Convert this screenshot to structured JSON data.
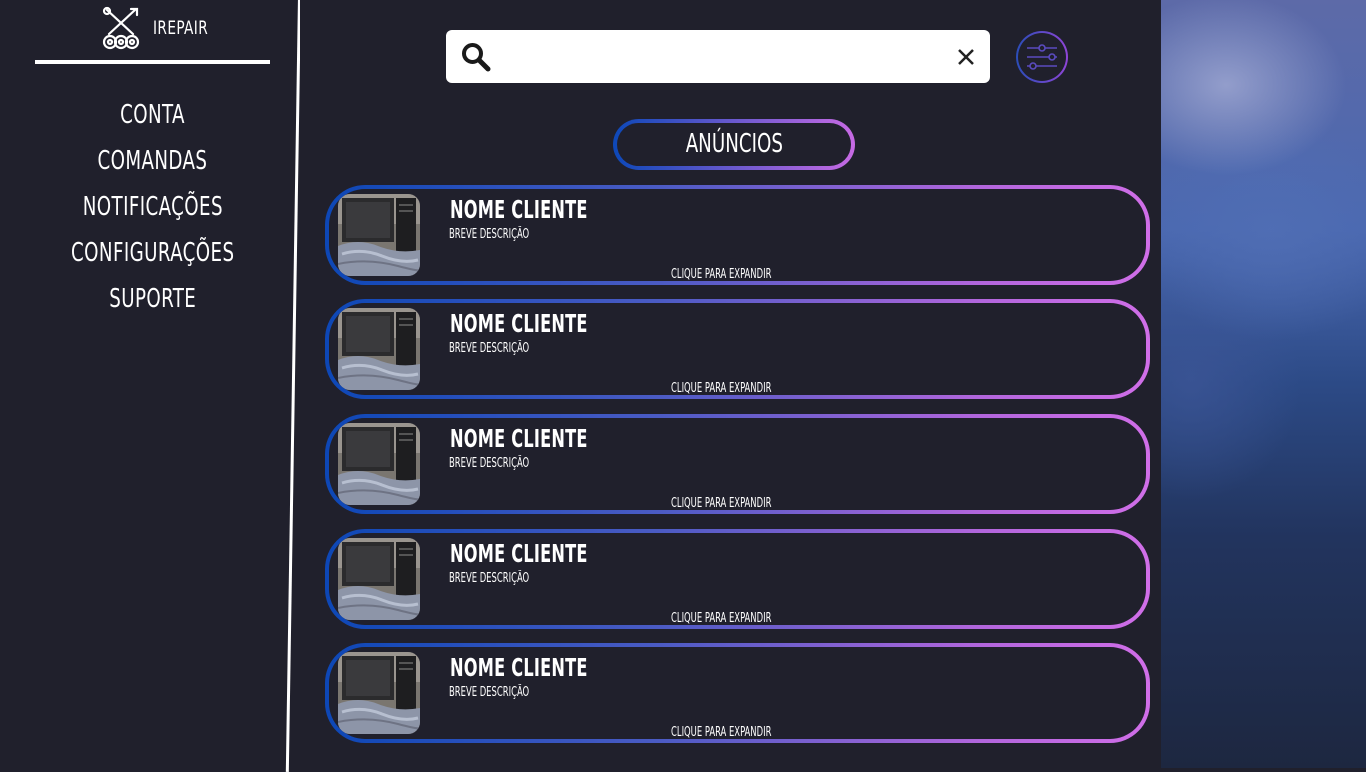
{
  "brand": {
    "name": "IREPAIR",
    "icon": "tools-gears-icon"
  },
  "nav": {
    "items": [
      {
        "label": "CONTA"
      },
      {
        "label": "COMANDAS"
      },
      {
        "label": "NOTIFICAÇÕES"
      },
      {
        "label": "CONFIGURAÇÕES"
      },
      {
        "label": "SUPORTE"
      }
    ]
  },
  "search": {
    "value": "",
    "placeholder": "",
    "icon": "search-icon",
    "clear_icon": "close-icon"
  },
  "filter": {
    "icon": "sliders-icon"
  },
  "tab": {
    "label": "ANÚNCIOS"
  },
  "cards": [
    {
      "name": "NOME CLIENTE",
      "description": "BREVE DESCRIÇÃO",
      "action": "CLIQUE PARA EXPANDIR"
    },
    {
      "name": "NOME CLIENTE",
      "description": "BREVE DESCRIÇÃO",
      "action": "CLIQUE PARA EXPANDIR"
    },
    {
      "name": "NOME CLIENTE",
      "description": "BREVE DESCRIÇÃO",
      "action": "CLIQUE PARA EXPANDIR"
    },
    {
      "name": "NOME CLIENTE",
      "description": "BREVE DESCRIÇÃO",
      "action": "CLIQUE PARA EXPANDIR"
    },
    {
      "name": "NOME CLIENTE",
      "description": "BREVE DESCRIÇÃO",
      "action": "CLIQUE PARA EXPANDIR"
    }
  ],
  "colors": {
    "background": "#20202c",
    "gradient_start": "#0d47b6",
    "gradient_end": "#d06ee8",
    "text": "#ffffff"
  }
}
